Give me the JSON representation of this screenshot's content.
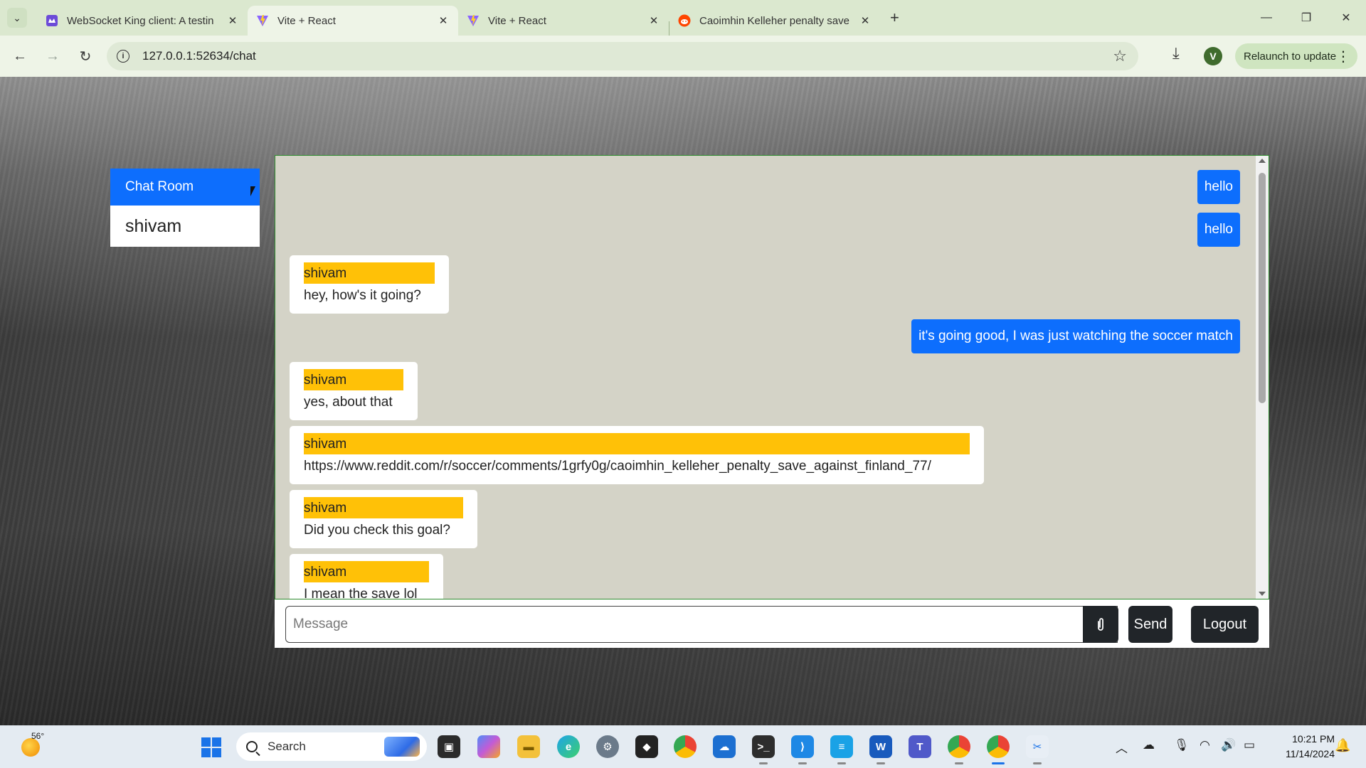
{
  "browser": {
    "tabs": [
      {
        "title": "WebSocket King client: A testin",
        "icon": "websocket-king-icon",
        "active": false
      },
      {
        "title": "Vite + React",
        "icon": "vite-icon",
        "active": true
      },
      {
        "title": "Vite + React",
        "icon": "vite-icon",
        "active": false
      },
      {
        "title": "Caoimhin Kelleher penalty save",
        "icon": "reddit-icon",
        "active": false
      }
    ],
    "new_tab": "+",
    "url": "127.0.0.1:52634/chat",
    "profile_initial": "V",
    "relaunch_label": "Relaunch to update"
  },
  "sidebar": {
    "header": "Chat Room",
    "users": [
      "shivam"
    ]
  },
  "chat": {
    "messages": [
      {
        "direction": "out",
        "text": "hello"
      },
      {
        "direction": "out",
        "text": "hello"
      },
      {
        "direction": "in",
        "sender": "shivam",
        "text": "hey, how's it going?"
      },
      {
        "direction": "out",
        "text": "it's going good, I was just watching the soccer match"
      },
      {
        "direction": "in",
        "sender": "shivam",
        "text": "yes, about that"
      },
      {
        "direction": "in",
        "sender": "shivam",
        "text": "https://www.reddit.com/r/soccer/comments/1grfy0g/caoimhin_kelleher_penalty_save_against_finland_77/"
      },
      {
        "direction": "in",
        "sender": "shivam",
        "text": "Did you check this goal?"
      },
      {
        "direction": "in",
        "sender": "shivam",
        "text": "I mean the save lol"
      }
    ],
    "input_placeholder": "Message",
    "input_value": "",
    "send_label": "Send",
    "logout_label": "Logout"
  },
  "taskbar": {
    "weather_temp": "56°",
    "search_label": "Search",
    "time": "10:21 PM",
    "date": "11/14/2024"
  },
  "colors": {
    "primary": "#0d6efd",
    "sender_highlight": "#ffc107",
    "chat_background": "#d4d3c7",
    "dark_button": "#212529"
  }
}
